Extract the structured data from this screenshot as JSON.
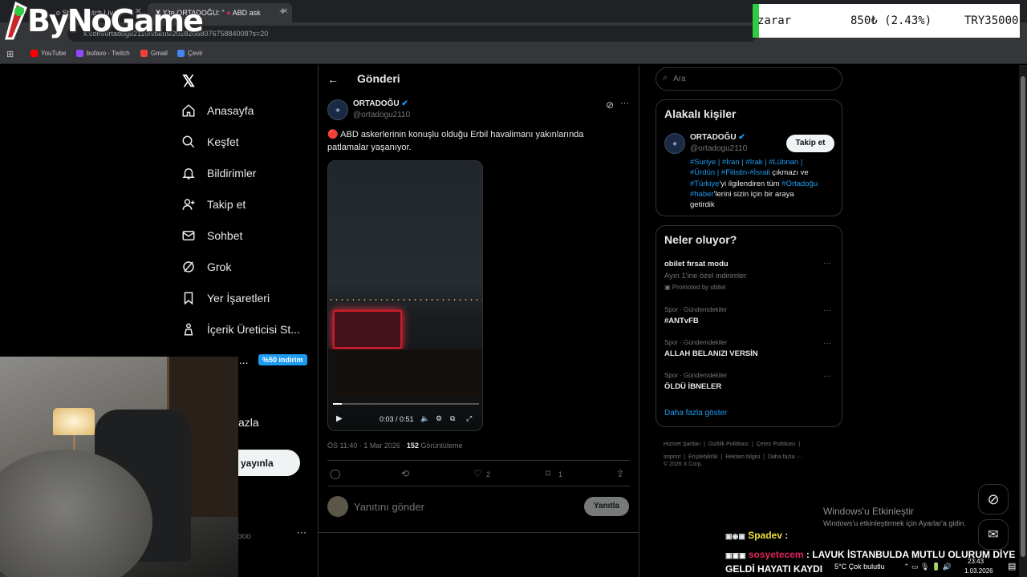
{
  "browser": {
    "tabs": [
      {
        "label": "o Stre",
        "active": false
      },
      {
        "label": "atch Liv",
        "active": false
      },
      {
        "label": "X'te ORTADOĞU: \"",
        "active": true
      },
      {
        "label": "ABD ask",
        "active": true
      }
    ],
    "new_tab": "+",
    "url": "x.com/ortadogu2110/status/2028208807675884008?s=20",
    "bookmarks": [
      {
        "label": "YouTube",
        "color": "#ff0000"
      },
      {
        "label": "bufavo - Twitch",
        "color": "#9146ff"
      },
      {
        "label": "Gmail",
        "color": "#ea4335"
      },
      {
        "label": "Çevir",
        "color": "#4285f4"
      }
    ]
  },
  "overlay": {
    "logo_text": "ByNoGame",
    "ticker": {
      "label": "zarar",
      "change": "850₺ (2.43%)",
      "total": "TRY35000"
    }
  },
  "sidebar": {
    "items": [
      {
        "label": "Anasayfa",
        "icon": "home-icon"
      },
      {
        "label": "Keşfet",
        "icon": "search-icon"
      },
      {
        "label": "Bildirimler",
        "icon": "bell-icon"
      },
      {
        "label": "Takip et",
        "icon": "add-user-icon"
      },
      {
        "label": "Sohbet",
        "icon": "mail-icon"
      },
      {
        "label": "Grok",
        "icon": "grok-icon"
      },
      {
        "label": "Yer İşaretleri",
        "icon": "bookmark-icon"
      },
      {
        "label": "İçerik Üreticisi St...",
        "icon": "creator-icon"
      },
      {
        "label": "u...",
        "icon": "premium-icon"
      }
    ],
    "premium_badge": "%50 indirim",
    "more_label": "azla",
    "post_button": "yayınla",
    "account_suffix": "ooo",
    "account_more": "···"
  },
  "main": {
    "header_title": "Gönderi",
    "author_name": "ORTADOĞU",
    "author_handle": "@ortadogu2110",
    "post_text": "🔴 ABD askerlerinin konuşlu olduğu Erbil havalimanı yakınlarında patlamalar yaşanıyor.",
    "video_time": "0:03 / 0:51",
    "meta_time": "ÖS 11:40 · 1 Mar 2026 · ",
    "views_count": "152",
    "views_label": " Görüntüleme",
    "likes": "2",
    "bookmarks": "1",
    "reply_placeholder": "Yanıtını gönder",
    "reply_button": "Yanıtla"
  },
  "right": {
    "search_placeholder": "Ara",
    "related_title": "Alakalı kişiler",
    "related_name": "ORTADOĞU",
    "related_handle": "@ortadogu2110",
    "follow_button": "Takip et",
    "bio_line1": "#Suriye | #İran | #Irak | #Lübnan |",
    "bio_line2_tags": "#Ürdün | #Filistin-#İsrail",
    "bio_line2_text": " çıkmazı ve",
    "bio_line3_tag": "#Türkiye",
    "bio_line3_text": "'yi ilgilendiren tüm ",
    "bio_line3_tag2": "#Ortadoğu",
    "bio_line4_tag": "#haber",
    "bio_line4_text": "'lerini sizin için bir araya",
    "bio_line5": "getirdik",
    "trends_title": "Neler oluyor?",
    "promo_title": "obilet fırsat modu",
    "promo_sub": "Ayın 1'ine özel indirimler",
    "promo_by": "Promoted by obilet",
    "trends": [
      {
        "category": "Spor · Gündemdekiler",
        "name": "#ANTvFB"
      },
      {
        "category": "Spor · Gündemdekiler",
        "name": "ALLAH BELANIZI VERSİN"
      },
      {
        "category": "Spor · Gündemdekiler",
        "name": "ÖLDÜ İBNELER"
      }
    ],
    "show_more": "Daha fazla göster",
    "footer_line1": [
      "Hizmet Şartları",
      "Gizlilik Politikası",
      "Çerez Politikası"
    ],
    "footer_line2": [
      "Imprint",
      "Erişilebilirlik",
      "Reklam bilgisi",
      "Daha fazla ···"
    ],
    "copyright": "© 2026 X Corp."
  },
  "desktop": {
    "activation_title": "Windows'u Etkinleştir",
    "activation_sub": "Windows'u etkinleştirmek için Ayarlar'a gidin.",
    "chat1_user": "Spadev",
    "chat1_sep": " :",
    "chat2_user": "sosyetecem",
    "chat2_text": " : LAVUK İSTANBULDA MUTLU OLURUM DİYE GELDİ HAYATI KAYDI",
    "weather": "5°C  Çok bulutlu",
    "clock_time": "23:43",
    "clock_date": "1.03.2026"
  },
  "colors": {
    "accent": "#1d9bf0",
    "ticker_green": "#2ecc40",
    "chat_user1": "#f0e040",
    "chat_user2": "#e0245e"
  }
}
